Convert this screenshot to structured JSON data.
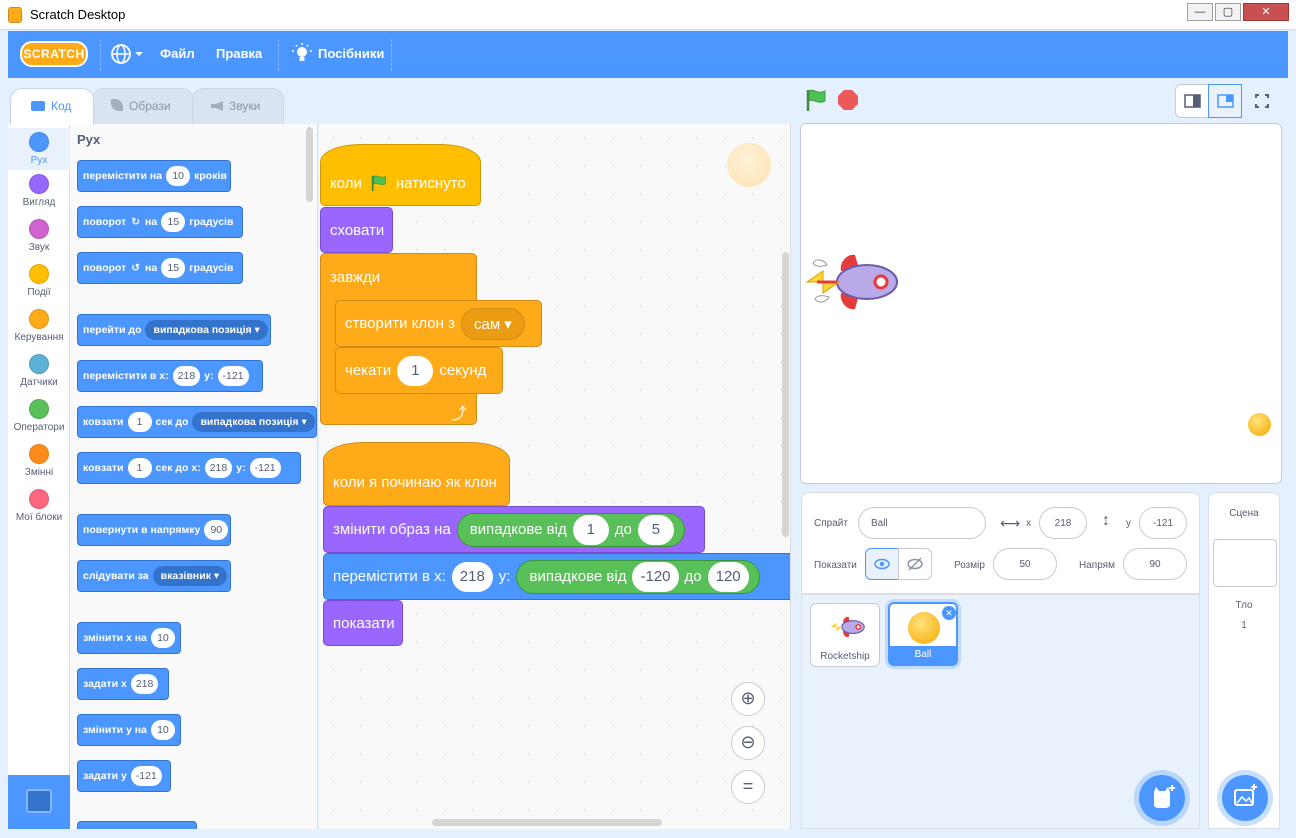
{
  "window": {
    "title": "Scratch Desktop"
  },
  "menu": {
    "logo": "SCRATCH",
    "file": "Файл",
    "edit": "Правка",
    "tutorials": "Посібники"
  },
  "tabs": {
    "code": "Код",
    "costumes": "Образи",
    "sounds": "Звуки"
  },
  "categories": [
    {
      "label": "Рух",
      "color": "#4c97ff"
    },
    {
      "label": "Вигляд",
      "color": "#9966ff"
    },
    {
      "label": "Звук",
      "color": "#cf63cf"
    },
    {
      "label": "Події",
      "color": "#ffbf00"
    },
    {
      "label": "Керування",
      "color": "#ffab19"
    },
    {
      "label": "Датчики",
      "color": "#5cb1d6"
    },
    {
      "label": "Оператори",
      "color": "#59c059"
    },
    {
      "label": "Змінні",
      "color": "#ff8c1a"
    },
    {
      "label": "Мої блоки",
      "color": "#ff6680"
    }
  ],
  "palette": {
    "section": "Рух",
    "blocks": {
      "move": {
        "a": "перемістити на",
        "n": "10",
        "b": "кроків"
      },
      "turn_right": {
        "a": "поворот",
        "b": "на",
        "n": "15",
        "c": "градусів"
      },
      "turn_left": {
        "a": "поворот",
        "b": "на",
        "n": "15",
        "c": "градусів"
      },
      "goto": {
        "a": "перейти до",
        "dd": "випадкова позиція"
      },
      "goto_xy": {
        "a": "перемістити в x:",
        "x": "218",
        "b": "y:",
        "y": "-121"
      },
      "glide_to": {
        "a": "ковзати",
        "n": "1",
        "b": "сек до",
        "dd": "випадкова позиція"
      },
      "glide_xy": {
        "a": "ковзати",
        "n": "1",
        "b": "сек до x:",
        "x": "218",
        "c": "y:",
        "y": "-121"
      },
      "point_dir": {
        "a": "повернути в напрямку",
        "n": "90"
      },
      "point_towards": {
        "a": "слідувати за",
        "dd": "вказівник"
      },
      "change_x": {
        "a": "змінити х на",
        "n": "10"
      },
      "set_x": {
        "a": "задати х",
        "n": "218"
      },
      "change_y": {
        "a": "змінити у на",
        "n": "10"
      },
      "set_y": {
        "a": "задати у",
        "n": "-121"
      }
    }
  },
  "script": {
    "s1": {
      "when_flag": {
        "a": "коли",
        "b": "натиснуто"
      },
      "hide": "сховати",
      "forever": "завжди",
      "clone": {
        "a": "створити клон з",
        "dd": "сам"
      },
      "wait": {
        "a": "чекати",
        "n": "1",
        "b": "секунд"
      }
    },
    "s2": {
      "hat": "коли я починаю як клон",
      "switch_costume": {
        "a": "змінити образ на",
        "op": "випадкове від",
        "from": "1",
        "to_label": "до",
        "to": "5"
      },
      "goto_xy": {
        "a": "перемістити в x:",
        "x": "218",
        "b": "y:",
        "op": "випадкове від",
        "from": "-120",
        "to_label": "до",
        "to": "120"
      },
      "show": "показати"
    }
  },
  "sprite_info": {
    "sprite_label": "Спрайт",
    "sprite_name": "Ball",
    "x_label": "x",
    "x": "218",
    "y_label": "y",
    "y": "-121",
    "show_label": "Показати",
    "size_label": "Розмір",
    "size": "50",
    "direction_label": "Напрям",
    "direction": "90"
  },
  "sprites": [
    {
      "name": "Rocketship",
      "selected": false
    },
    {
      "name": "Ball",
      "selected": true
    }
  ],
  "stage_pane": {
    "title": "Сцена",
    "backdrops_label": "Тло",
    "backdrops_count": "1"
  },
  "colors": {
    "accent": "#4c97ff",
    "events": "#ffbf00",
    "control": "#ffab19",
    "looks": "#9966ff",
    "operators": "#59c059"
  }
}
